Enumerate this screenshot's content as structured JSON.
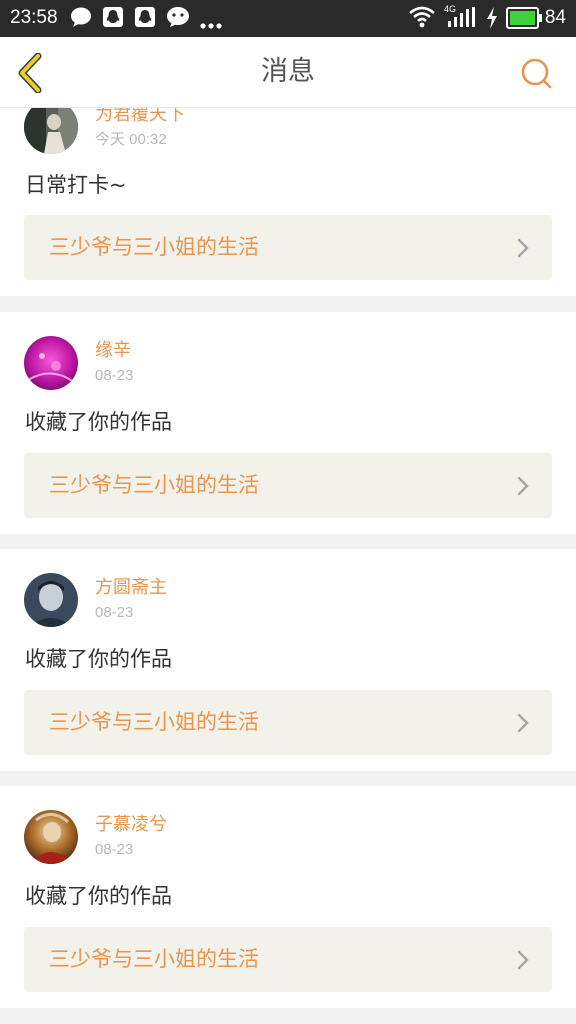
{
  "status_bar": {
    "time": "23:58",
    "network": "4G",
    "battery": "84",
    "icons": [
      "chat-bubble-icon",
      "qq-icon",
      "qq-icon",
      "wechat-icon",
      "more-dots-icon",
      "wifi-icon",
      "signal-icon",
      "charging-icon",
      "battery-icon"
    ],
    "battery_color": "#3bd23b"
  },
  "header": {
    "title": "消息",
    "back_icon": "back-chevron-icon",
    "search_icon": "search-icon",
    "back_color": "#d9c21f",
    "accent": "#e8954f"
  },
  "messages": [
    {
      "user": "为君覆天下",
      "date": "今天 00:32",
      "text": "日常打卡~",
      "work": "三少爷与三小姐的生活"
    },
    {
      "user": "缘辛",
      "date": "08-23",
      "text": "收藏了你的作品",
      "work": "三少爷与三小姐的生活"
    },
    {
      "user": "方圆斋主",
      "date": "08-23",
      "text": "收藏了你的作品",
      "work": "三少爷与三小姐的生活"
    },
    {
      "user": "子慕凌兮",
      "date": "08-23",
      "text": "收藏了你的作品",
      "work": "三少爷与三小姐的生活"
    }
  ]
}
